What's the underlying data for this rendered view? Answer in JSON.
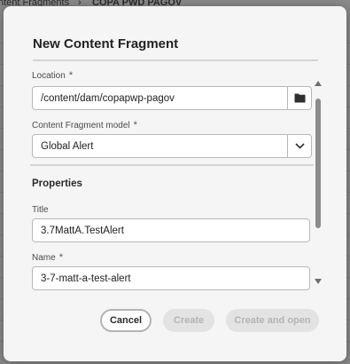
{
  "background": {
    "breadcrumb": [
      "ntent Fragments",
      "COPA PWD PAGOV"
    ],
    "separator": "›"
  },
  "dialog": {
    "title": "New Content Fragment",
    "location": {
      "label": "Location",
      "required_mark": "*",
      "value": "/content/dam/copapwp-pagov",
      "browse_icon": "folder-icon"
    },
    "model": {
      "label": "Content Fragment model",
      "required_mark": "*",
      "selected": "Global Alert",
      "dropdown_icon": "chevron-down-icon"
    },
    "properties": {
      "heading": "Properties",
      "title": {
        "label": "Title",
        "value": "3.7MattA.TestAlert"
      },
      "name": {
        "label": "Name",
        "required_mark": "*",
        "value": "3-7-matt-a-test-alert"
      }
    },
    "buttons": {
      "cancel": "Cancel",
      "create": "Create",
      "create_and_open": "Create and open"
    }
  },
  "colors": {
    "overlay": "#8a8a8a",
    "dialog_bg": "#f5f5f5",
    "disabled_button_bg": "#e3e3e3",
    "disabled_button_text": "#b4b4b4"
  }
}
